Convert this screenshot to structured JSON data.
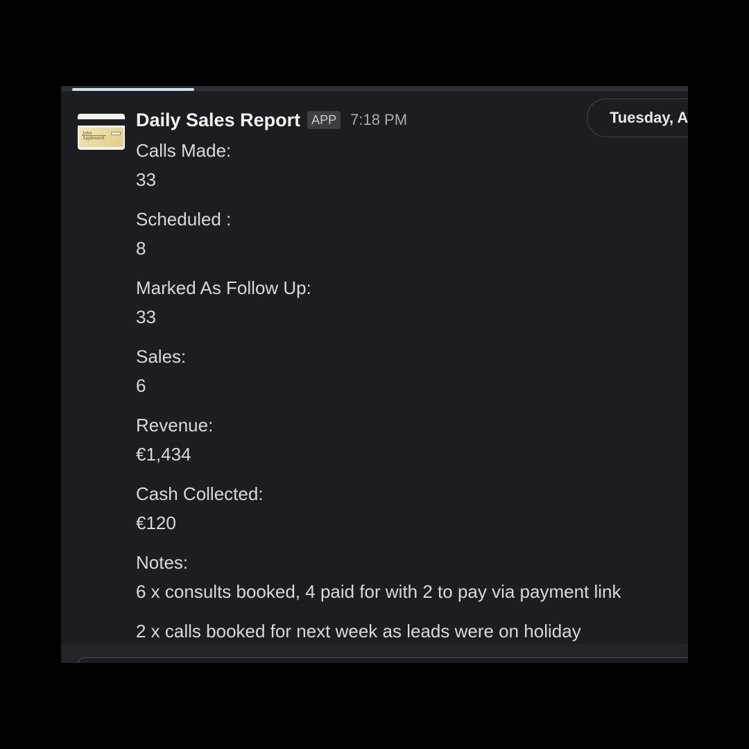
{
  "message": {
    "sender": "Daily Sales Report",
    "badge": "APP",
    "time": "7:18 PM",
    "date_divider": "Tuesday, A",
    "avatar_icon": "credit-card-icon",
    "fields": [
      {
        "label": "Calls Made:",
        "value": "33"
      },
      {
        "label": "Scheduled :",
        "value": "8"
      },
      {
        "label": "Marked As Follow Up:",
        "value": "33"
      },
      {
        "label": "Sales:",
        "value": "6"
      },
      {
        "label": "Revenue:",
        "value": "€1,434"
      },
      {
        "label": "Cash Collected:",
        "value": "€120"
      }
    ],
    "notes": {
      "label": "Notes:",
      "lines": [
        "6 x consults booked, 4 paid for with 2 to pay via payment link",
        "2 x calls booked for next week as leads were on holiday"
      ]
    }
  },
  "colors": {
    "background": "#000000",
    "panel": "#1c1d20",
    "text": "#d8d9da",
    "sender": "#f2f2f2",
    "muted": "#a9abae",
    "loading_bar": "#cfe3ef"
  }
}
